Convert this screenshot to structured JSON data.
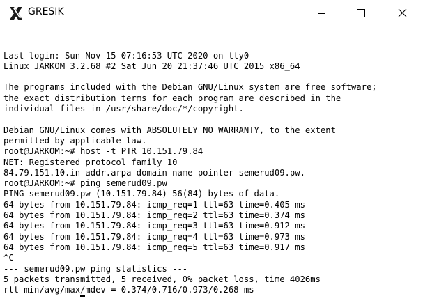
{
  "window": {
    "title": "GRESIK",
    "icon": "x-app-icon",
    "controls": [
      "minimize-icon",
      "maximize-icon",
      "close-icon"
    ]
  },
  "terminal": {
    "lines": [
      "Last login: Sun Nov 15 07:16:53 UTC 2020 on tty0",
      "Linux JARKOM 3.2.68 #2 Sat Jun 20 21:37:46 UTC 2015 x86_64",
      "",
      "The programs included with the Debian GNU/Linux system are free software;",
      "the exact distribution terms for each program are described in the",
      "individual files in /usr/share/doc/*/copyright.",
      "",
      "Debian GNU/Linux comes with ABSOLUTELY NO WARRANTY, to the extent",
      "permitted by applicable law.",
      "root@JARKOM:~# host -t PTR 10.151.79.84",
      "NET: Registered protocol family 10",
      "84.79.151.10.in-addr.arpa domain name pointer semerud09.pw.",
      "root@JARKOM:~# ping semerud09.pw",
      "PING semerud09.pw (10.151.79.84) 56(84) bytes of data.",
      "64 bytes from 10.151.79.84: icmp_req=1 ttl=63 time=0.405 ms",
      "64 bytes from 10.151.79.84: icmp_req=2 ttl=63 time=0.374 ms",
      "64 bytes from 10.151.79.84: icmp_req=3 ttl=63 time=0.912 ms",
      "64 bytes from 10.151.79.84: icmp_req=4 ttl=63 time=0.973 ms",
      "64 bytes from 10.151.79.84: icmp_req=5 ttl=63 time=0.917 ms",
      "^C",
      "--- semerud09.pw ping statistics ---",
      "5 packets transmitted, 5 received, 0% packet loss, time 4026ms",
      "rtt min/avg/max/mdev = 0.374/0.716/0.973/0.268 ms"
    ],
    "prompt": "root@JARKOM:~# "
  }
}
